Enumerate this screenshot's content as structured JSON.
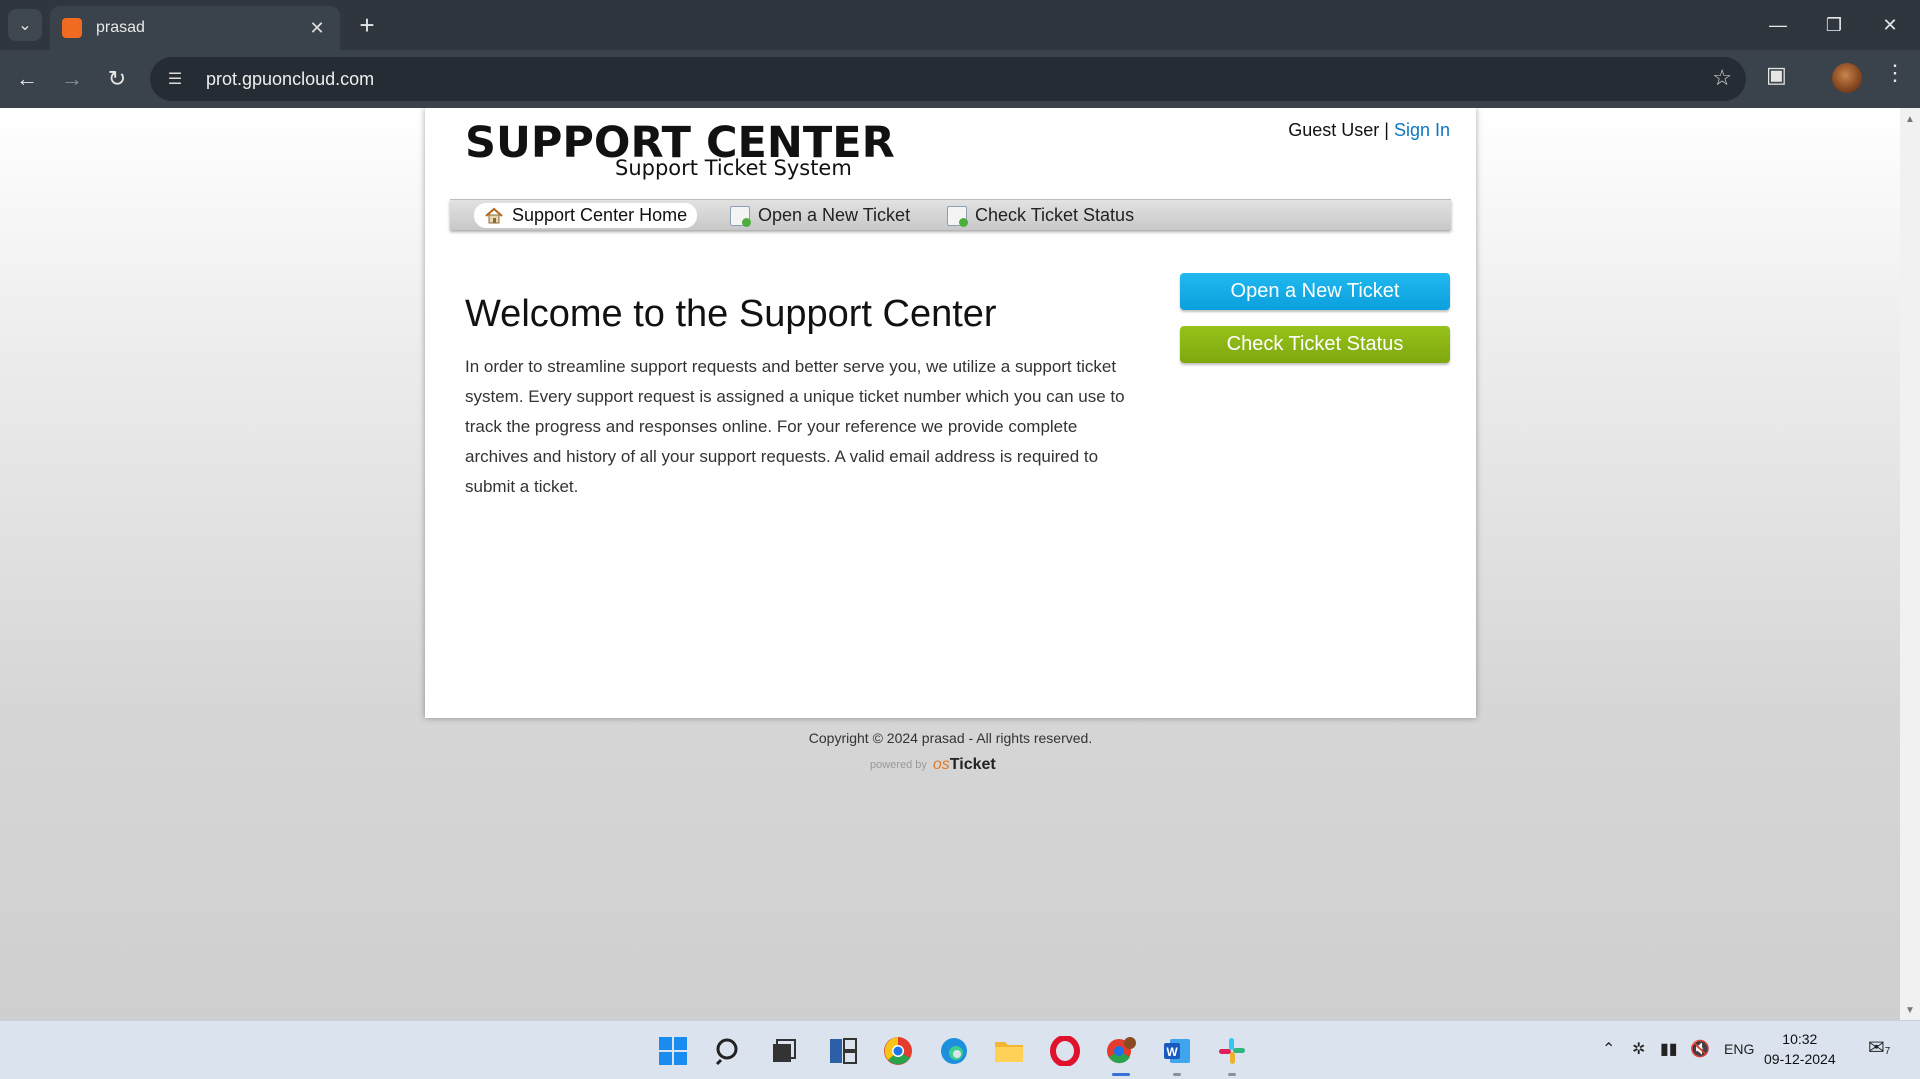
{
  "browser": {
    "tab_title": "prasad",
    "url": "prot.gpuoncloud.com"
  },
  "page": {
    "logo_title": "SUPPORT CENTER",
    "logo_subtitle": "Support Ticket System",
    "user_label": "Guest User",
    "separator": "|",
    "sign_in": "Sign In",
    "nav": [
      {
        "label": "Support Center Home",
        "active": true
      },
      {
        "label": "Open a New Ticket",
        "active": false
      },
      {
        "label": "Check Ticket Status",
        "active": false
      }
    ],
    "welcome_title": "Welcome to the Support Center",
    "intro_text": "In order to streamline support requests and better serve you, we utilize a support ticket system. Every support request is assigned a unique ticket number which you can use to track the progress and responses online. For your reference we provide complete archives and history of all your support requests. A valid email address is required to submit a ticket.",
    "buttons": {
      "open_ticket": "Open a New Ticket",
      "check_status": "Check Ticket Status"
    },
    "footer": {
      "copyright": "Copyright © 2024 prasad - All rights reserved.",
      "powered_by": "powered by",
      "brand_os": "os",
      "brand_ticket": "Ticket"
    }
  },
  "taskbar": {
    "language": "ENG",
    "time": "10:32",
    "date": "09-12-2024",
    "notification_count": "7"
  },
  "colors": {
    "link": "#0c76c1",
    "button_blue": "#0aa0dd",
    "button_green": "#7fa80f"
  }
}
